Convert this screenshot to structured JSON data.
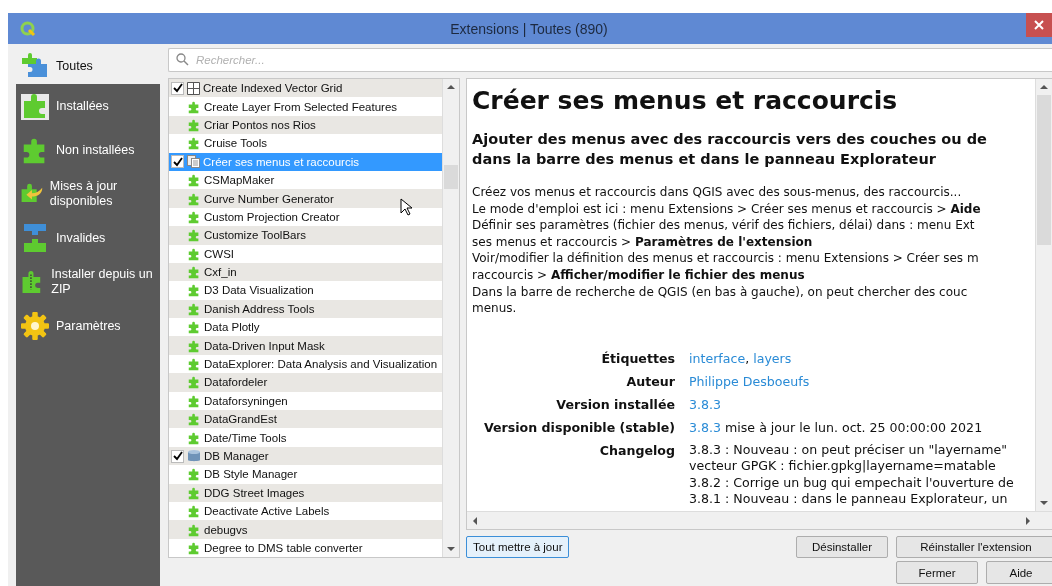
{
  "window": {
    "title": "Extensions | Toutes (890)"
  },
  "sidebar": {
    "items": [
      {
        "label": "Toutes",
        "kind": "multi",
        "selected": true
      },
      {
        "label": "Installées",
        "kind": "installed",
        "selected": false
      },
      {
        "label": "Non installées",
        "kind": "plugin",
        "selected": false
      },
      {
        "label": "Mises à jour disponibles",
        "kind": "upgrade",
        "selected": false
      },
      {
        "label": "Invalides",
        "kind": "broken",
        "selected": false
      },
      {
        "label": "Installer depuis un ZIP",
        "kind": "zip",
        "selected": false
      },
      {
        "label": "Paramètres",
        "kind": "gear",
        "selected": false
      }
    ]
  },
  "search": {
    "placeholder": "Rechercher..."
  },
  "plugins": [
    {
      "name": "Create Indexed Vector Grid",
      "kind": "grid",
      "checked": true,
      "selected": false
    },
    {
      "name": "Create Layer From Selected Features",
      "kind": "plugin",
      "checked": false,
      "selected": false
    },
    {
      "name": "Criar Pontos nos Rios",
      "kind": "plugin",
      "checked": false,
      "selected": false
    },
    {
      "name": "Cruise Tools",
      "kind": "plugin",
      "checked": false,
      "selected": false
    },
    {
      "name": "Créer ses menus et raccourcis",
      "kind": "menu",
      "checked": true,
      "selected": true
    },
    {
      "name": "CSMapMaker",
      "kind": "plugin",
      "checked": false,
      "selected": false
    },
    {
      "name": "Curve Number Generator",
      "kind": "plugin",
      "checked": false,
      "selected": false
    },
    {
      "name": "Custom Projection Creator",
      "kind": "plugin",
      "checked": false,
      "selected": false
    },
    {
      "name": "Customize ToolBars",
      "kind": "plugin",
      "checked": false,
      "selected": false
    },
    {
      "name": "CWSI",
      "kind": "plugin",
      "checked": false,
      "selected": false
    },
    {
      "name": "Cxf_in",
      "kind": "plugin",
      "checked": false,
      "selected": false
    },
    {
      "name": "D3 Data Visualization",
      "kind": "plugin",
      "checked": false,
      "selected": false
    },
    {
      "name": "Danish Address Tools",
      "kind": "plugin",
      "checked": false,
      "selected": false
    },
    {
      "name": "Data Plotly",
      "kind": "plugin",
      "checked": false,
      "selected": false
    },
    {
      "name": "Data-Driven Input Mask",
      "kind": "plugin",
      "checked": false,
      "selected": false
    },
    {
      "name": "DataExplorer: Data Analysis and Visualization",
      "kind": "plugin",
      "checked": false,
      "selected": false
    },
    {
      "name": "Datafordeler",
      "kind": "plugin",
      "checked": false,
      "selected": false
    },
    {
      "name": "Dataforsyningen",
      "kind": "plugin",
      "checked": false,
      "selected": false
    },
    {
      "name": "DataGrandEst",
      "kind": "plugin",
      "checked": false,
      "selected": false
    },
    {
      "name": "Date/Time Tools",
      "kind": "plugin",
      "checked": false,
      "selected": false
    },
    {
      "name": "DB Manager",
      "kind": "database",
      "checked": true,
      "selected": false
    },
    {
      "name": "DB Style Manager",
      "kind": "plugin",
      "checked": false,
      "selected": false
    },
    {
      "name": "DDG Street Images",
      "kind": "plugin",
      "checked": false,
      "selected": false
    },
    {
      "name": "Deactivate Active Labels",
      "kind": "plugin",
      "checked": false,
      "selected": false
    },
    {
      "name": "debugvs",
      "kind": "plugin",
      "checked": false,
      "selected": false
    },
    {
      "name": "Degree to DMS table converter",
      "kind": "plugin",
      "checked": false,
      "selected": false
    }
  ],
  "details": {
    "title": "Créer ses menus et raccourcis",
    "subtitle_lines": [
      "Ajouter des menus avec des raccourcis vers des couches ou de",
      "dans la barre des menus et dans le panneau Explorateur"
    ],
    "description_lines": [
      "Créez vos menus et raccourcis dans QGIS avec des sous-menus, des raccourcis...",
      "Le mode d'emploi est ici : menu Extensions > Créer ses menus et raccourcis > **Aide**",
      "Définir ses paramètres (fichier des menus, vérif des fichiers, délai) dans : menu Ext",
      "ses menus et raccourcis > **Paramètres de l'extension**",
      "Voir/modifier la définition des menus et raccourcis : menu Extensions > Créer ses m",
      "raccourcis > **Afficher/modifier le fichier des menus**",
      "Dans la barre de recherche de QGIS (en bas à gauche), on peut chercher des couc",
      "menus."
    ],
    "info": [
      {
        "label": "Étiquettes",
        "kind": "links",
        "parts": [
          {
            "text": "interface",
            "kind": "link"
          },
          {
            "text": ",",
            "kind": "text"
          },
          {
            "text": "layers",
            "kind": "link"
          }
        ]
      },
      {
        "label": "Auteur",
        "kind": "links",
        "parts": [
          {
            "text": "Philippe Desboeufs",
            "kind": "link"
          }
        ]
      },
      {
        "label": "Version installée",
        "kind": "links",
        "parts": [
          {
            "text": "3.8.3",
            "kind": "link"
          }
        ]
      },
      {
        "label": "Version disponible (stable)",
        "kind": "links",
        "parts": [
          {
            "text": "3.8.3",
            "kind": "link"
          },
          {
            "text": "mise à jour le lun. oct. 25 00:00:00 2021",
            "kind": "text"
          }
        ]
      },
      {
        "label": "Changelog",
        "kind": "lines",
        "lines": [
          "3.8.3 : Nouveau : on peut préciser un \"layername\"",
          "vecteur GPGK : fichier.gpkg|layername=matable",
          "3.8.2 : Corrige un bug qui empechait l'ouverture de",
          "3.8.1 : Nouveau : dans le panneau Explorateur, un"
        ]
      }
    ]
  },
  "buttons": {
    "update_all": "Tout mettre à jour",
    "uninstall": "Désinstaller",
    "reinstall": "Réinstaller l'extension",
    "close": "Fermer",
    "help": "Aide"
  }
}
